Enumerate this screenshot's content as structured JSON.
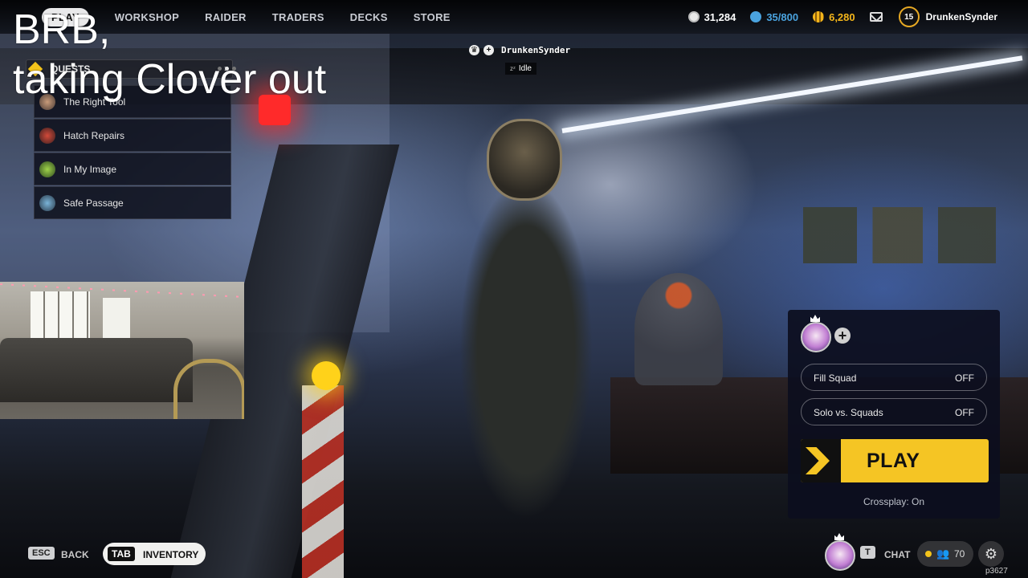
{
  "nav": {
    "items": [
      "PLAY",
      "WORKSHOP",
      "RAIDER",
      "TRADERS",
      "DECKS",
      "STORE"
    ],
    "active_index": 0
  },
  "currencies": {
    "coins": "31,284",
    "blue": "35/800",
    "gold": "6,280",
    "level": "15",
    "username": "DrunkenSynder",
    "blue_color": "#4aa3df",
    "gold_color": "#f3b51b"
  },
  "overlay": {
    "brb_text": "BRB,\ntaking Clover out"
  },
  "quests": {
    "header": "QUESTS",
    "items": [
      {
        "label": "The Right Tool",
        "icon": "quest-portrait-icon"
      },
      {
        "label": "Hatch Repairs",
        "icon": "quest-portrait-icon"
      },
      {
        "label": "In My Image",
        "icon": "quest-portrait-icon"
      },
      {
        "label": "Safe Passage",
        "icon": "quest-portrait-icon"
      }
    ]
  },
  "player_tag": {
    "name": "DrunkenSynder",
    "status": "Idle"
  },
  "squad": {
    "fill_squad_label": "Fill Squad",
    "fill_squad_value": "OFF",
    "solo_label": "Solo vs. Squads",
    "solo_value": "OFF",
    "play_label": "PLAY",
    "crossplay": "Crossplay: On",
    "accent_color": "#f5c524"
  },
  "bottom": {
    "esc_key": "ESC",
    "back_label": "BACK",
    "tab_key": "TAB",
    "inventory_label": "INVENTORY",
    "chat_key": "T",
    "chat_label": "CHAT",
    "friends_count": "70",
    "build_code": "p3627"
  }
}
